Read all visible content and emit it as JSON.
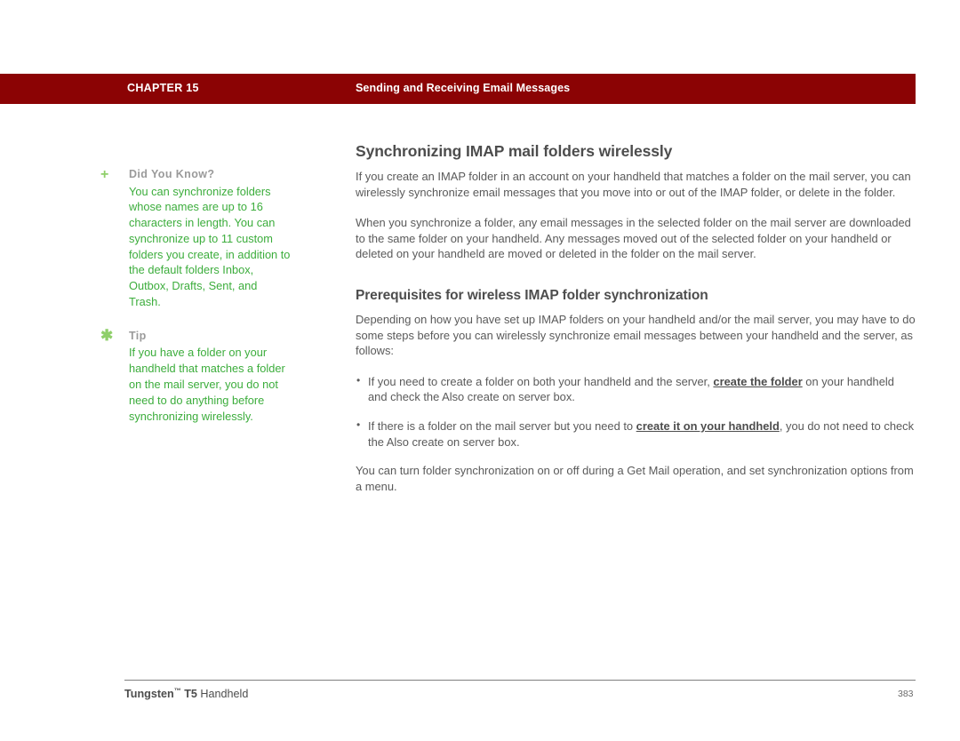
{
  "header": {
    "chapter_label": "CHAPTER 15",
    "section_title": "Sending and Receiving Email Messages",
    "bar_color": "#8b0304"
  },
  "sidebar": {
    "notes": [
      {
        "icon": "plus-icon",
        "icon_glyph": "+",
        "label": "Did You Know?",
        "text": "You can synchronize folders whose names are up to 16 characters in length. You can synchronize up to 11 custom folders you create, in addition to the default folders Inbox, Outbox, Drafts, Sent, and Trash."
      },
      {
        "icon": "asterisk-icon",
        "icon_glyph": "✱",
        "label": "Tip",
        "text": "If you have a folder on your handheld that matches a folder on the mail server, you do not need to do anything before synchronizing wirelessly."
      }
    ],
    "text_color": "#3cad3c",
    "label_color": "#9a9a9a"
  },
  "content": {
    "section_heading": "Synchronizing IMAP mail folders wirelessly",
    "paragraph_1": "If you create an IMAP folder in an account on your handheld that matches a folder on the mail server, you can wirelessly synchronize email messages that you move into or out of the IMAP folder, or delete in the folder.",
    "paragraph_2": "When you synchronize a folder, any email messages in the selected folder on the mail server are downloaded to the same folder on your handheld. Any messages moved out of the selected folder on your handheld or deleted on your handheld are moved or deleted in the folder on the mail server.",
    "subsection_heading": "Prerequisites for wireless IMAP folder synchronization",
    "paragraph_3": "Depending on how you have set up IMAP folders on your handheld and/or the mail server, you may have to do some steps before you can wirelessly synchronize email messages between your handheld and the server, as follows:",
    "bullets": [
      {
        "before": "If you need to create a folder on both your handheld and the server, ",
        "link": "create the folder",
        "after": " on your handheld and check the Also create on server box."
      },
      {
        "before": "If there is a folder on the mail server but you need to ",
        "link": "create it on your handheld",
        "after": ", you do not need to check the Also create on server box."
      }
    ],
    "paragraph_4": "You can turn folder synchronization on or off during a Get Mail operation, and set synchronization options from a menu."
  },
  "footer": {
    "product_bold": "Tungsten",
    "trademark": "™",
    "model_bold": " T5",
    "product_rest": " Handheld",
    "page_number": "383"
  }
}
